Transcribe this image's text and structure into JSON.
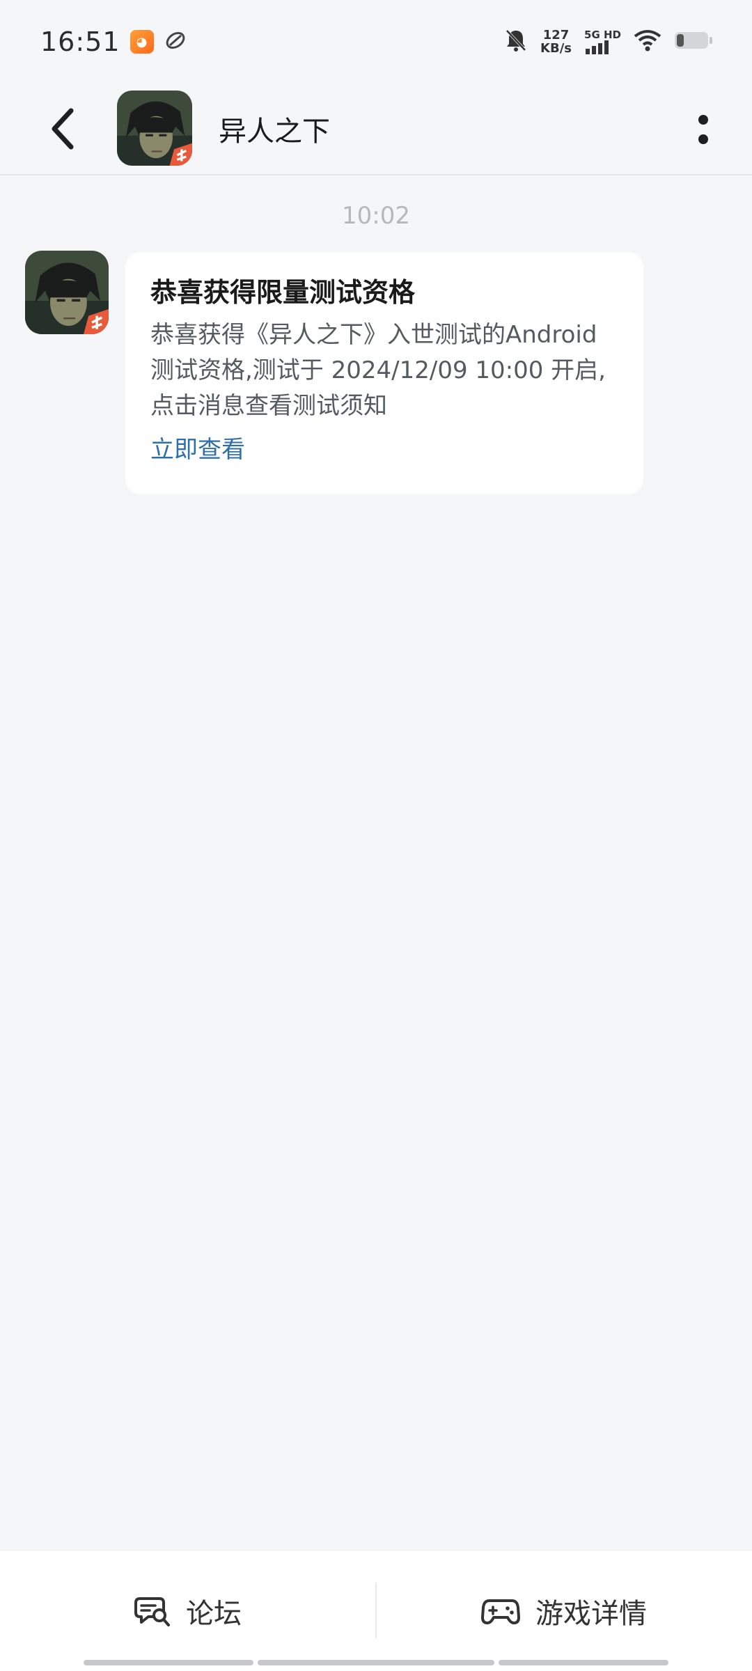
{
  "status_bar": {
    "time": "16:51",
    "net_speed_value": "127",
    "net_speed_unit": "KB/s",
    "network_label": "5G HD",
    "icons": [
      "app-notification-icon",
      "sync-icon",
      "mute-bell-icon",
      "signal-icon",
      "wifi-icon",
      "battery-icon"
    ]
  },
  "header": {
    "title": "异人之下",
    "back_icon": "chevron-left-icon",
    "more_icon": "more-vertical-icon"
  },
  "conversation": {
    "timestamp": "10:02",
    "message": {
      "title": "恭喜获得限量测试资格",
      "body_line1": "恭喜获得《异人之下》入世测试的Android",
      "body_line2": "测试资格,测试于 2024/12/09 10:00 开启,",
      "body_line3": "点击消息查看测试须知",
      "link": "立即查看"
    }
  },
  "bottom_bar": {
    "forum_label": "论坛",
    "forum_icon": "forum-search-icon",
    "game_detail_label": "游戏详情",
    "game_detail_icon": "gamepad-icon"
  },
  "colors": {
    "background": "#f5f6f8",
    "link": "#2f6fa8",
    "timestamp": "#b4b8bf"
  }
}
